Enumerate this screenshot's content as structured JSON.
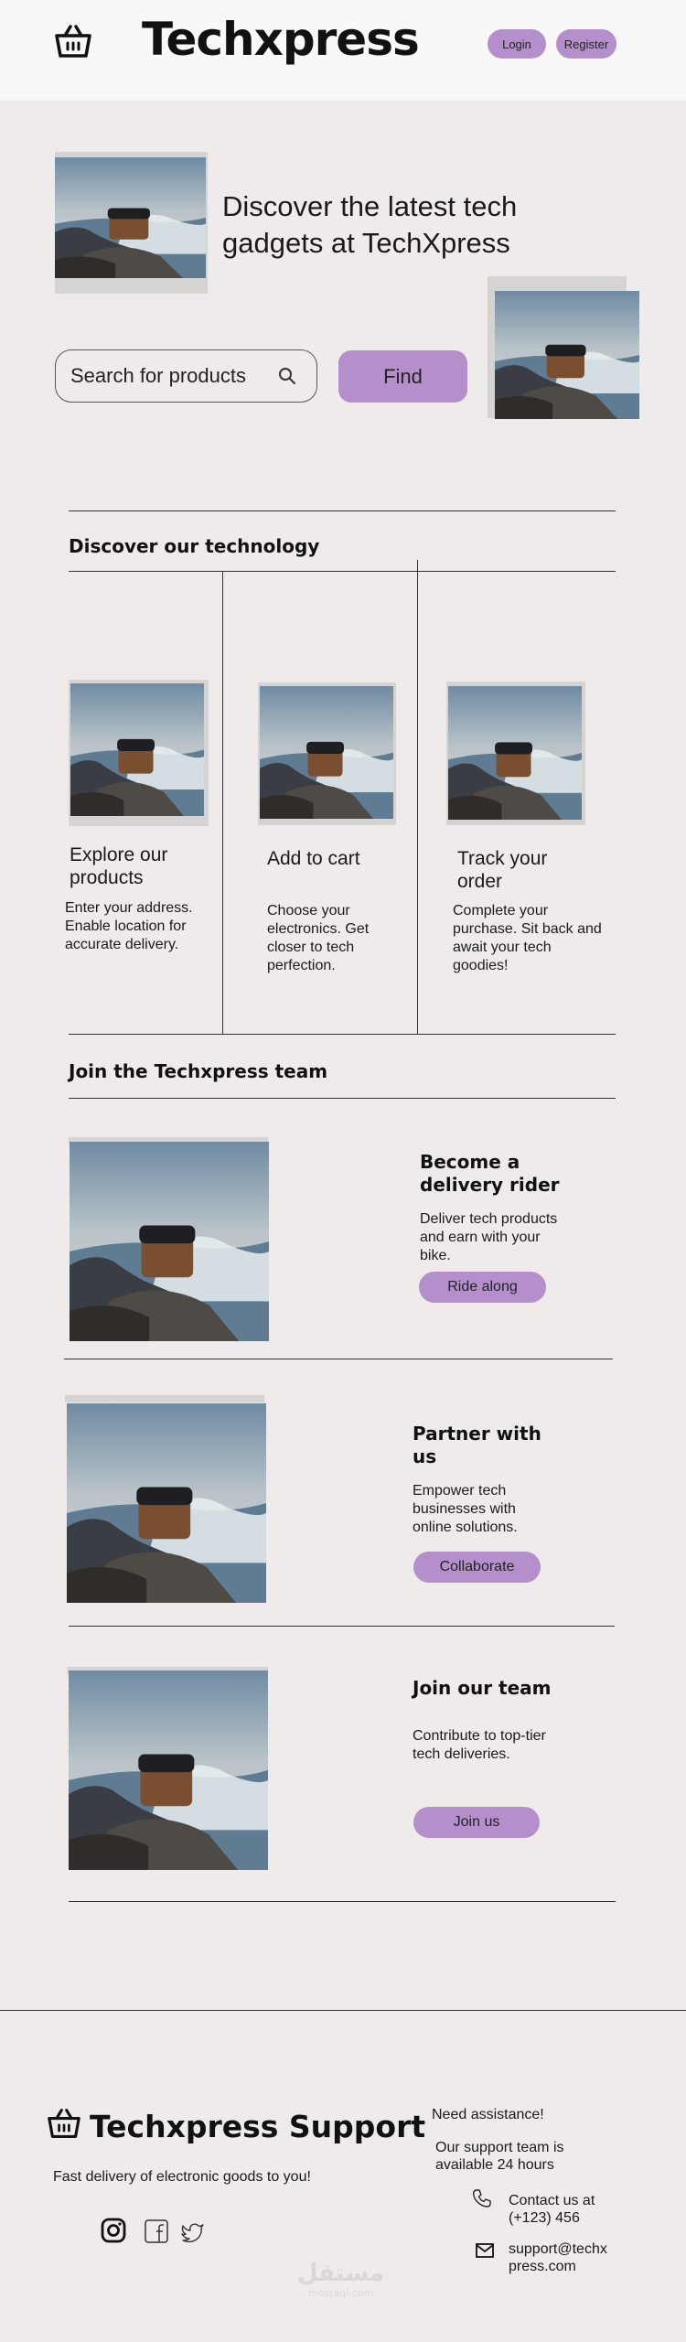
{
  "header": {
    "brand": "Techxpress",
    "login_label": "Login",
    "register_label": "Register"
  },
  "hero": {
    "headline_line1": "Discover the latest tech",
    "headline_line2": "gadgets at TechXpress",
    "search_placeholder": "Search for products",
    "find_label": "Find"
  },
  "technology": {
    "title": "Discover our technology",
    "steps": [
      {
        "title": "Explore our products",
        "desc": "Enter your address. Enable location for accurate delivery."
      },
      {
        "title": "Add to cart",
        "desc": "Choose your electronics. Get closer to tech perfection."
      },
      {
        "title": "Track your order",
        "desc": "Complete your purchase. Sit back and await your tech goodies!"
      }
    ]
  },
  "team": {
    "title": "Join the Techxpress team",
    "cards": [
      {
        "title": "Become a delivery rider",
        "desc": "Deliver tech products and earn with your bike.",
        "button": "Ride along"
      },
      {
        "title": "Partner with us",
        "desc": "Empower tech businesses with online solutions.",
        "button": "Collaborate"
      },
      {
        "title": "Join our team",
        "desc": "Contribute to top-tier tech deliveries.",
        "button": "Join us"
      }
    ]
  },
  "footer": {
    "brand": "Techxpress Support",
    "tagline": "Fast delivery of electronic goods to you!",
    "need_assistance": "Need assistance!",
    "support_hours": "Our support team is available 24 hours",
    "contact_label": "Contact us at",
    "phone": "(+123) 456",
    "email": "support@techxpress.com",
    "social_icons": [
      "instagram-icon",
      "facebook-icon",
      "twitter-icon"
    ]
  },
  "watermark": {
    "arabic": "مستقل",
    "latin": "mostaql.com"
  },
  "colors": {
    "accent": "#b58fcb",
    "background": "#efebea",
    "header": "#f8f8f8"
  }
}
